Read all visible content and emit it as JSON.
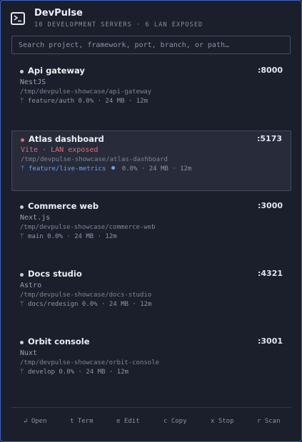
{
  "app": {
    "title": "DevPulse",
    "subtitle": "10 DEVELOPMENT SERVERS · 6 LAN EXPOSED"
  },
  "search": {
    "placeholder": "Search project, framework, port, branch, or path…",
    "value": ""
  },
  "servers": [
    {
      "name": "Api gateway",
      "port": ":8000",
      "framework": "NestJS",
      "path": "/tmp/devpulse-showcase/api-gateway",
      "branch": "feature/auth",
      "cpu": "0.0%",
      "memory": "24 MB",
      "uptime": "12m"
    },
    {
      "name": "Atlas dashboard",
      "port": ":5173",
      "framework": "Vite · LAN exposed",
      "path": "/tmp/devpulse-showcase/atlas-dashboard",
      "branch": "feature/live-metrics",
      "cpu": "0.0%",
      "memory": "24 MB",
      "uptime": "12m",
      "selected": true
    },
    {
      "name": "Commerce web",
      "port": ":3000",
      "framework": "Next.js",
      "path": "/tmp/devpulse-showcase/commerce-web",
      "branch": "main",
      "cpu": "0.0%",
      "memory": "24 MB",
      "uptime": "12m"
    },
    {
      "name": "Docs studio",
      "port": ":4321",
      "framework": "Astro",
      "path": "/tmp/devpulse-showcase/docs-studio",
      "branch": "docs/redesign",
      "cpu": "0.0%",
      "memory": "24 MB",
      "uptime": "12m"
    },
    {
      "name": "Orbit console",
      "port": ":3001",
      "framework": "Nuxt",
      "path": "/tmp/devpulse-showcase/orbit-console",
      "branch": "develop",
      "cpu": "0.0%",
      "memory": "24 MB",
      "uptime": "12m"
    }
  ],
  "separator": "·",
  "footer": {
    "open": "↲ Open",
    "term": "t Term",
    "edit": "e Edit",
    "copy": "c Copy",
    "stop": "x Stop",
    "scan": "r Scan"
  },
  "colors": {
    "accent": "#6ea1f0",
    "alert": "#e06c7a",
    "border": "#3e63c9",
    "background": "#1b1e2b"
  }
}
